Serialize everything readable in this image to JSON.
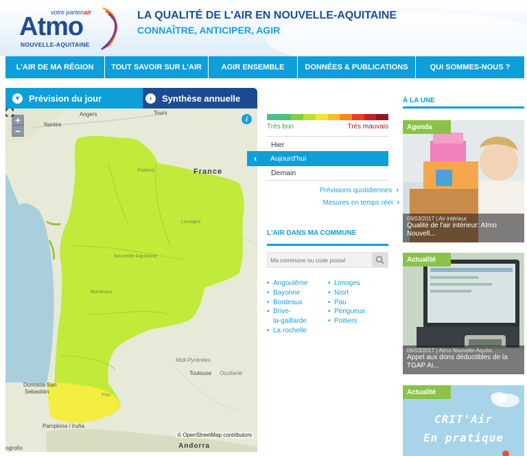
{
  "header": {
    "logo": {
      "tagline_prefix": "votre parten",
      "tagline_suffix": "air",
      "name": "Atmo",
      "region": "NOUVELLE-AQUITAINE"
    },
    "title": "LA QUALITÉ DE L'AIR EN NOUVELLE-AQUITAINE",
    "subtitle": "CONNAÎTRE, ANTICIPER, AGIR"
  },
  "nav": [
    {
      "label": "L'AIR DE MA RÉGION"
    },
    {
      "label": "TOUT SAVOIR SUR L'AIR"
    },
    {
      "label": "AGIR ENSEMBLE"
    },
    {
      "label": "DONNÉES & PUBLICATIONS"
    },
    {
      "label": "QUI SOMMES-NOUS ?"
    }
  ],
  "map_panel": {
    "tabs": [
      {
        "label": "Prévision du jour",
        "active": true
      },
      {
        "label": "Synthèse annuelle",
        "active": false
      }
    ],
    "zoom_in": "+",
    "zoom_out": "−",
    "info": "i",
    "labels": {
      "angers": "Angers",
      "tours": "Tours",
      "nantes": "Nantes",
      "poitiers": "Poitiers",
      "france": "France",
      "limoges": "Limoges",
      "nouvelle_aquitaine": "Nouvelle-Aquitaine",
      "bordeaux": "Bordeaux",
      "midi_pyrenees": "Midi-Pyrénées",
      "toulouse": "Toulouse",
      "occitanie": "Occitanie",
      "donostia": "Donostia-San",
      "sebastian": "Sebastián",
      "pau": "Pau",
      "pamplona": "Pamplona / Iruña",
      "andorra": "Andorra",
      "logrono": "ogroño"
    },
    "attribution": "© OpenStreetMap contributors",
    "colors": {
      "region_fill": "#c1eb3a",
      "region_south": "#f3ee3f",
      "sea": "#a9cfdc",
      "land": "#e9ecd8"
    }
  },
  "forecast": {
    "scale_colors": [
      "#4bbf8f",
      "#52c073",
      "#7dd142",
      "#b7e236",
      "#f0e634",
      "#f6c02b",
      "#ef8a22",
      "#e5421e",
      "#c81f22",
      "#8b1a1a"
    ],
    "scale_good": "Très bon",
    "scale_bad": "Très mauvais",
    "days": {
      "yesterday": "Hier",
      "today": "Aujourd'hui",
      "tomorrow": "Demain"
    },
    "links": {
      "daily": "Prévisions quotidiennes",
      "realtime": "Mesures en temps réel"
    }
  },
  "commune": {
    "title": "L'AIR DANS MA COMMUNE",
    "search_placeholder": "Ma commune ou code postal",
    "cities_left": [
      "Angoulême",
      "Bayonne",
      "Bordeaux",
      "Brive-",
      "la-gaillarde",
      "La rochelle"
    ],
    "cities_right": [
      "Limoges",
      "Niort",
      "Pau",
      "Périgueux",
      "Poitiers"
    ]
  },
  "news": {
    "title": "À LA UNE",
    "cards": [
      {
        "tag": "Agenda",
        "date": "09/03/2017 | Air intérieur",
        "title": "Qualité de l'air intérieur: Atmo Nouvell..."
      },
      {
        "tag": "Actualité",
        "date": "06/03/2017 | Atmo Nouvelle-Aquita...",
        "title": "Appel aux dons déductibles de la TGAP Ai..."
      },
      {
        "tag": "Actualité",
        "image_text_1": "CRIT'Air",
        "image_text_2": "En pratique"
      }
    ]
  }
}
